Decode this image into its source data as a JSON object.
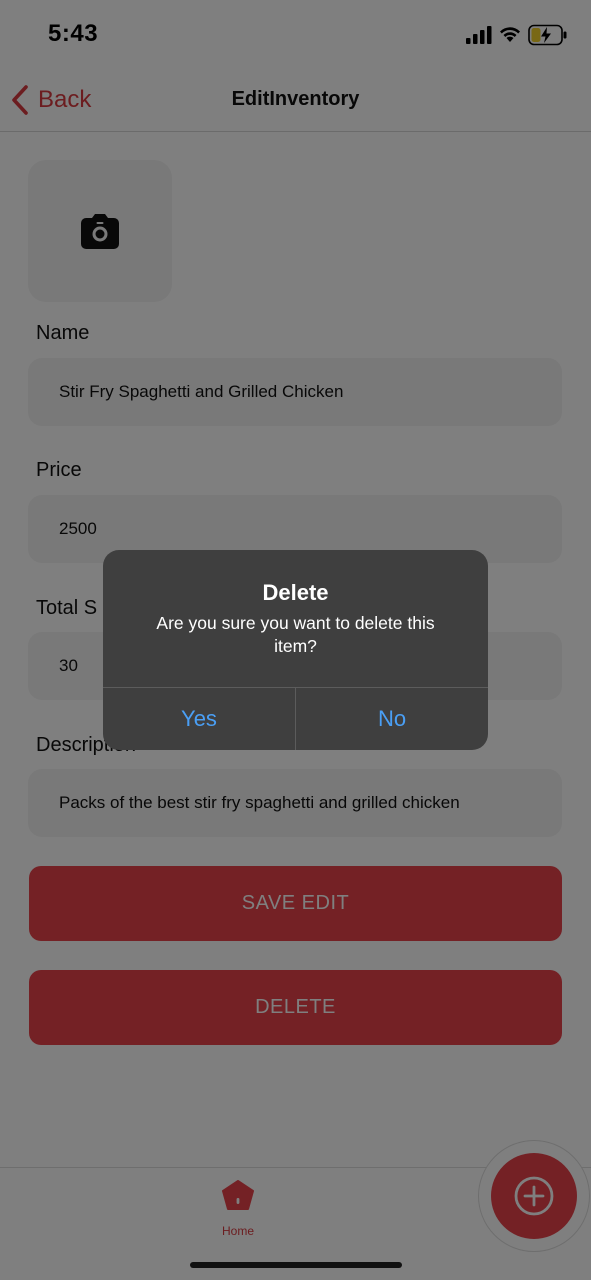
{
  "status_bar": {
    "time": "5:43",
    "icons": [
      "signal-icon",
      "wifi-icon",
      "battery-charging-icon"
    ]
  },
  "nav": {
    "back_label": "Back",
    "title": "EditInventory",
    "accent_color": "#d93a40"
  },
  "photo": {
    "icon": "camera-icon"
  },
  "form": {
    "name_label": "Name",
    "name_value": "Stir Fry Spaghetti and Grilled Chicken",
    "price_label": "Price",
    "price_value": "2500",
    "stock_label": "Total S",
    "stock_value": "30",
    "description_label": "Description",
    "description_value": "Packs of the best stir fry spaghetti and grilled chicken"
  },
  "buttons": {
    "save_label": "SAVE EDIT",
    "delete_label": "DELETE",
    "color": "#e8424a"
  },
  "tab_bar": {
    "home_label": "Home",
    "home_icon": "home-icon",
    "fab_icon": "plus-icon"
  },
  "alert": {
    "title": "Delete",
    "message": "Are you sure you want to delete this item?",
    "yes_label": "Yes",
    "no_label": "No",
    "button_color": "#4a9ff5"
  }
}
